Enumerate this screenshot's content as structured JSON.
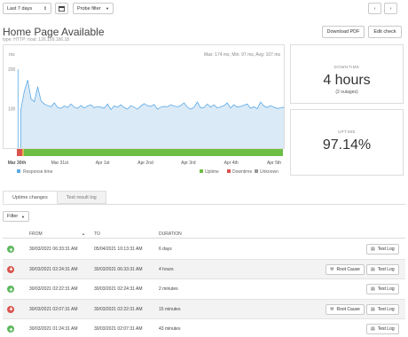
{
  "toolbar": {
    "range_label": "Last 7 days",
    "probe_filter_label": "Probe filter"
  },
  "header": {
    "title": "Home Page Available",
    "subtitle": "type: HTTP; host: 126.199.186.18",
    "download_pdf": "Download PDF",
    "edit_check": "Edit check"
  },
  "chart_data": {
    "type": "line",
    "title": "",
    "ylabel": "ms",
    "ylim": [
      0,
      250
    ],
    "yticks": [
      100,
      200
    ],
    "stats_text": "Max: 174 ms, Min: 97 ms, Avg: 107 ms",
    "x_labels": [
      "Mar 30th",
      "Mar 31st",
      "Apr 1st",
      "Apr 2nd",
      "Apr 3rd",
      "Apr 4th",
      "Apr 5th"
    ],
    "series": [
      {
        "name": "Response time",
        "color": "#5aa9e6",
        "values": [
          100,
          101,
          145,
          173,
          125,
          118,
          156,
          120,
          112,
          108,
          105,
          115,
          103,
          101,
          107,
          103,
          112,
          104,
          101,
          108,
          102,
          107,
          110,
          103,
          105,
          104,
          101,
          112,
          98,
          107,
          104,
          110,
          103,
          99,
          108,
          104,
          99,
          107,
          113,
          108,
          106,
          111,
          99,
          104,
          106,
          105,
          110,
          107,
          105,
          108,
          115,
          104,
          99,
          104,
          117,
          102,
          103,
          112,
          104,
          110,
          102,
          105,
          108,
          115,
          102,
          110,
          104,
          106,
          109,
          112,
          101,
          105,
          100,
          117,
          107,
          103,
          108,
          104,
          101,
          102,
          104
        ]
      }
    ],
    "status_bar": [
      {
        "status": "down",
        "color": "#d9534f",
        "fraction": 0.02
      },
      {
        "status": "unknown",
        "color": "#f0ad4e",
        "fraction": 0.006
      },
      {
        "status": "up",
        "color": "#6cbe45",
        "fraction": 0.974
      }
    ],
    "legend_left": [
      {
        "name": "Response time",
        "color": "#5aa9e6"
      }
    ],
    "legend_right": [
      {
        "name": "Uptime",
        "color": "#6cbe45"
      },
      {
        "name": "Downtime",
        "color": "#d9534f"
      },
      {
        "name": "Unknown",
        "color": "#999999"
      }
    ]
  },
  "stats": {
    "downtime_label": "DOWNTIME",
    "downtime_value": "4 hours",
    "downtime_sub": "(2 outages)",
    "uptime_label": "UPTIME",
    "uptime_value": "97.14%"
  },
  "tabs": {
    "uptime_changes": "Uptime changes",
    "test_result_log": "Test result log"
  },
  "filter_label": "Filter",
  "table": {
    "headers": {
      "from": "FROM",
      "to": "TO",
      "duration": "DURATION"
    },
    "root_cause_label": "Root Cause",
    "test_log_label": "Test Log",
    "rows": [
      {
        "status": "up",
        "from": "30/03/2021 06:33:31 AM",
        "to": "05/04/2021 10:13:31 AM",
        "duration": "6 days"
      },
      {
        "status": "down",
        "from": "30/03/2021 02:24:31 AM",
        "to": "30/03/2021 06:33:31 AM",
        "duration": "4 hours"
      },
      {
        "status": "up",
        "from": "30/03/2021 02:22:31 AM",
        "to": "30/03/2021 02:24:31 AM",
        "duration": "2 minutes"
      },
      {
        "status": "down",
        "from": "30/03/2021 02:07:31 AM",
        "to": "30/03/2021 02:22:31 AM",
        "duration": "15 minutes"
      },
      {
        "status": "up",
        "from": "30/03/2021 01:24:31 AM",
        "to": "30/03/2021 02:07:31 AM",
        "duration": "43 minutes"
      }
    ]
  }
}
